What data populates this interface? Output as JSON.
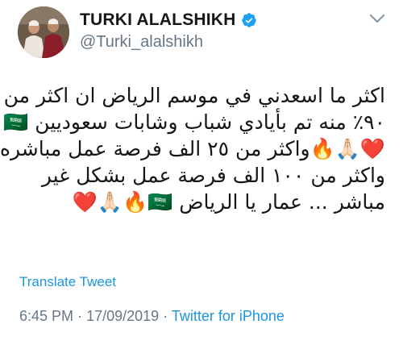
{
  "author": {
    "display_name": "TURKI ALALSHIKH",
    "handle": "@Turki_alalshikh",
    "verified_icon": "verified-badge-icon",
    "avatar": "profile-photo"
  },
  "menu": {
    "icon": "chevron-down-icon"
  },
  "tweet": {
    "lines": [
      "اكثر ما اسعدني في موسم الرياض ان اكثر من",
      "٩٠٪ منه تم بأيادي شباب وشابات سعوديين 🇸🇦",
      "❤️🙏🏻🔥واكثر من ٢٥ الف فرصة عمل مباشره",
      "واكثر من ١٠٠ الف فرصة عمل بشكل غير",
      "مباشر ... عمار يا الرياض 🇸🇦🔥🙏🏻❤️"
    ]
  },
  "translate_label": "Translate Tweet",
  "meta": {
    "time": "6:45 PM",
    "separator": "·",
    "date": "17/09/2019",
    "source": "Twitter for iPhone"
  },
  "colors": {
    "link": "#1b95e0",
    "secondary_text": "#657786",
    "primary_text": "#14171a",
    "verified": "#1da1f2"
  }
}
